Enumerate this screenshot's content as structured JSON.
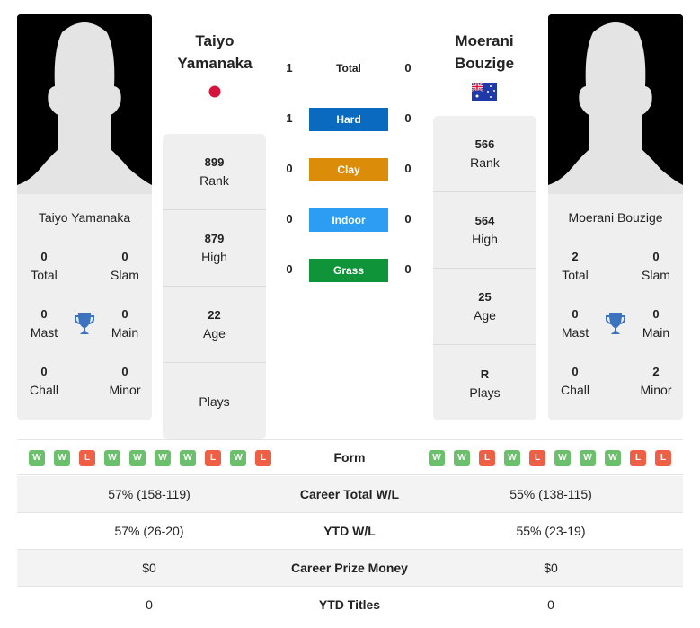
{
  "player1": {
    "name": "Taiyo Yamanaka",
    "name_line1": "Taiyo",
    "name_line2": "Yamanaka",
    "flag": "japan-flag",
    "titles": {
      "total": {
        "value": "0",
        "label": "Total"
      },
      "slam": {
        "value": "0",
        "label": "Slam"
      },
      "mast": {
        "value": "0",
        "label": "Mast"
      },
      "main": {
        "value": "0",
        "label": "Main"
      },
      "chall": {
        "value": "0",
        "label": "Chall"
      },
      "minor": {
        "value": "0",
        "label": "Minor"
      }
    },
    "stats": [
      {
        "value": "899",
        "label": "Rank"
      },
      {
        "value": "879",
        "label": "High"
      },
      {
        "value": "22",
        "label": "Age"
      },
      {
        "value": "",
        "label": "Plays"
      }
    ],
    "form": [
      "W",
      "W",
      "L",
      "W",
      "W",
      "W",
      "W",
      "L",
      "W",
      "L"
    ]
  },
  "player2": {
    "name": "Moerani Bouzige",
    "name_line1": "Moerani",
    "name_line2": "Bouzige",
    "flag": "australia-flag",
    "titles": {
      "total": {
        "value": "2",
        "label": "Total"
      },
      "slam": {
        "value": "0",
        "label": "Slam"
      },
      "mast": {
        "value": "0",
        "label": "Mast"
      },
      "main": {
        "value": "0",
        "label": "Main"
      },
      "chall": {
        "value": "0",
        "label": "Chall"
      },
      "minor": {
        "value": "2",
        "label": "Minor"
      }
    },
    "stats": [
      {
        "value": "566",
        "label": "Rank"
      },
      {
        "value": "564",
        "label": "High"
      },
      {
        "value": "25",
        "label": "Age"
      },
      {
        "value": "R",
        "label": "Plays"
      }
    ],
    "form": [
      "W",
      "W",
      "L",
      "W",
      "L",
      "W",
      "W",
      "W",
      "L",
      "L"
    ]
  },
  "h2h": [
    {
      "label": "Total",
      "p1": "1",
      "p2": "0",
      "color": ""
    },
    {
      "label": "Hard",
      "p1": "1",
      "p2": "0",
      "color": "#0a6abf"
    },
    {
      "label": "Clay",
      "p1": "0",
      "p2": "0",
      "color": "#db8c09"
    },
    {
      "label": "Indoor",
      "p1": "0",
      "p2": "0",
      "color": "#2c9df3"
    },
    {
      "label": "Grass",
      "p1": "0",
      "p2": "0",
      "color": "#0f9439"
    }
  ],
  "form_label": "Form",
  "comparison": [
    {
      "label": "Career Total W/L",
      "p1": "57% (158-119)",
      "p2": "55% (138-115)"
    },
    {
      "label": "YTD W/L",
      "p1": "57% (26-20)",
      "p2": "55% (23-19)"
    },
    {
      "label": "Career Prize Money",
      "p1": "$0",
      "p2": "$0"
    },
    {
      "label": "YTD Titles",
      "p1": "0",
      "p2": "0"
    }
  ]
}
